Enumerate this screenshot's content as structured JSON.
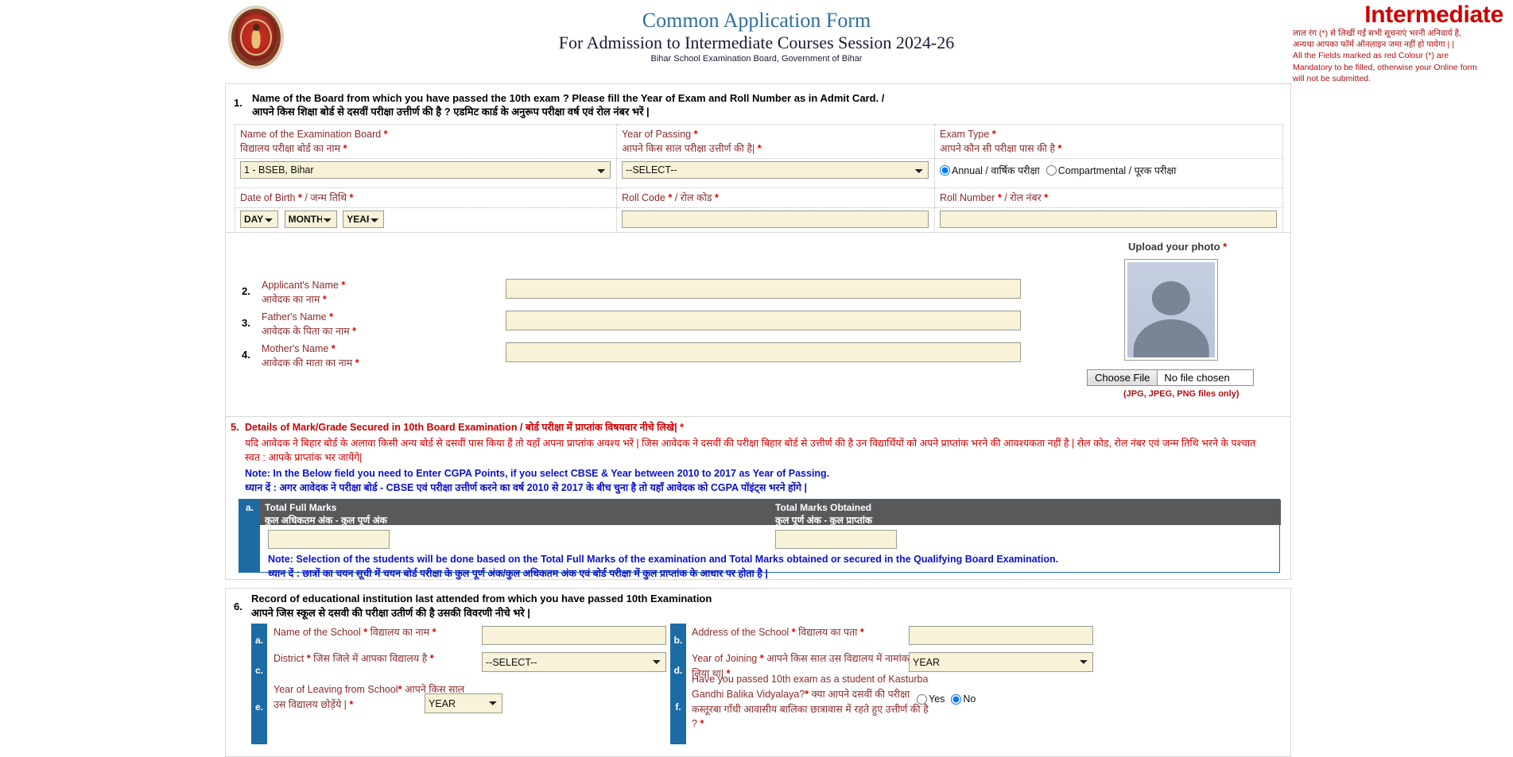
{
  "header": {
    "title": "Common Application Form",
    "subtitle": "For Admission to Intermediate Courses Session 2024-26",
    "board": "Bihar School Examination Board, Government of Bihar",
    "right_title": "Intermediate",
    "right_hi_1": "लाल रंग (*) से लिखीं गईं सभी सूचनाएं भरनी अनिवार्य है,",
    "right_hi_2": "अन्यथा आपका फॉर्म ऑनलाइन जमा नहीं हो पायेगा | |",
    "right_en_1": "All the Fields marked as red Colour (*) are",
    "right_en_2": "Mandatory to be filled, otherwise your Online form",
    "right_en_3": "will not be submitted."
  },
  "section1": {
    "num": "1.",
    "q_en": "Name of the Board from which you have passed the 10th exam ? Please fill the Year of Exam and Roll Number as in Admit Card. /",
    "q_hi": "आपने किस शिक्षा बोर्ड से दसवीं परीक्षा उत्तीर्ण की है ? एडमिट कार्ड के अनुरूप परीक्षा वर्ष एवं रोल नंबर भरें |",
    "board_label_en": "Name of the Examination Board",
    "board_label_hi": "विद्यालय परीक्षा बोर्ड का नाम",
    "board_value": "1 - BSEB, Bihar",
    "year_label_en": "Year of Passing",
    "year_label_hi": "आपने किस साल परीक्षा उत्तीर्ण की है|",
    "year_value": "--SELECT--",
    "examtype_label_en": "Exam Type",
    "examtype_label_hi": "आपने कौन सी परीक्षा पास की है",
    "examtype_options": [
      "Annual / वार्षिक परीक्षा",
      "Compartmental / पूरक परीक्षा"
    ],
    "examtype_selected": "Annual / वार्षिक परीक्षा",
    "dob_label": "Date of Birth",
    "dob_label_hi": "जन्म तिथि",
    "dob_day": "DAY",
    "dob_month": "MONTH",
    "dob_year": "YEAR",
    "rollcode_label_en": "Roll Code",
    "rollcode_label_hi": "रोल कोड",
    "rollcode_value": "",
    "rollnumber_label_en": "Roll Number",
    "rollnumber_label_hi": "रोल नंबर",
    "rollnumber_value": ""
  },
  "names": {
    "applicant_num": "2.",
    "applicant_en": "Applicant's Name",
    "applicant_hi": "आवेदक का नाम",
    "applicant_value": "",
    "father_num": "3.",
    "father_en": "Father's Name",
    "father_hi": "आवेदक के पिता का नाम",
    "father_value": "",
    "mother_num": "4.",
    "mother_en": "Mother's Name",
    "mother_hi": "आवेदक की माता का नाम",
    "mother_value": ""
  },
  "photo": {
    "label": "Upload your photo",
    "choose_button": "Choose File",
    "file_status": "No file chosen",
    "note": "(JPG, JPEG, PNG files only)"
  },
  "section5": {
    "num": "5.",
    "head": "Details of Mark/Grade Secured in 10th Board Examination / बोर्ड परीक्षा में प्राप्तांक विषयवार नीचे लिखे|",
    "hi_1": "यदि आवेदक ने बिहार बोर्ड के अलावा किसी अन्य बोर्ड से दसवीं पास किया हैं तो यहाँ अपना प्राप्तांक अवश्य भरें | जिस आवेदक ने दसवीं की परीक्षा बिहार बोर्ड से उत्तीर्ण की है उन विद्यार्थियों को अपने प्राप्तांक भरने की आवश्यकता नहीं है | रोल कोड, रोल नंबर एवं जन्म तिथि भरने के पश्चात",
    "hi_2": "स्वत : आपके प्राप्तांक भर जायेंगे|",
    "note_en": "Note: In the Below field you need to Enter CGPA Points, if you select CBSE & Year between 2010 to 2017 as Year of Passing.",
    "note_hi": "ध्यान दें : अगर आवेदक ने परीक्षा बोर्ड - CBSE एवं परीक्षा उत्तीर्ण करने का वर्ष 2010 से 2017 के बीच चुना है तो यहाँ आवेदक को CGPA पॉइंट्स भरने होंगे |",
    "row_letter": "a.",
    "col1_en": "Total Full Marks",
    "col1_hi": "कुल अधिकतम अंक - कुल पूर्ण अंक",
    "col1_value": "",
    "col2_en": "Total Marks Obtained",
    "col2_hi": "कुल पूर्ण अंक - कुल प्राप्तांक",
    "col2_value": "",
    "bottom_note_en": "Note: Selection of the students will be done based on the Total Full Marks of the examination and Total Marks obtained or secured in the Qualifying Board Examination.",
    "bottom_note_hi": "ध्यान दें : छात्रों का चयन सूची में चयन बोर्ड परीक्षा के कुल पूर्ण अंक/कुल अधिकतम अंक एवं बोर्ड परीक्षा में कुल प्राप्तांक के आधार पर होता है |"
  },
  "section6": {
    "num": "6.",
    "q_en": "Record of educational institution last attended from which you have passed 10th Examination",
    "q_hi": "आपने जिस स्कूल से दसवी की परीक्षा उतीर्ण की है उसकी विवरणी नीचे भरे |",
    "a_letter": "a.",
    "a_en": "Name of the School",
    "a_hi": "विद्यालय का नाम",
    "a_value": "",
    "b_letter": "b.",
    "b_en": "Address of the School",
    "b_hi": "विद्यालय का पता",
    "b_value": "",
    "c_letter": "c.",
    "c_en": "District",
    "c_hi": "जिस जिले में आपका विद्यालय है",
    "c_value": "--SELECT--",
    "d_letter": "d.",
    "d_en": "Year of Joining",
    "d_hi": "आपने किस साल उस विद्यालय में नामांकन लिया था|",
    "d_value": "YEAR",
    "e_letter": "e.",
    "e_en": "Year of Leaving from School",
    "e_hi": "आपने किस साल उस विद्यालय छोड़ेंये |",
    "e_value": "YEAR",
    "f_letter": "f.",
    "f_en_1": "Have you passed 10th exam as a student of Kasturba Gandhi",
    "f_en_2": "Balika Vidyalaya?",
    "f_hi_1": "क्या आपने दसवीं की परीक्षा कस्तूरबा गाँधी आवासीय बालिका छात्रावास",
    "f_hi_2": "में रहते हुए उत्तीर्ण की है ?",
    "f_options": [
      "Yes",
      "No"
    ],
    "f_selected": "No"
  },
  "colors": {
    "accent_blue": "#1d6ba5",
    "label_maroon": "#8b2b2b",
    "required_red": "#e00000",
    "note_blue": "#0a12c8",
    "field_bg": "#f7f2d8",
    "table_header": "#58595b"
  }
}
